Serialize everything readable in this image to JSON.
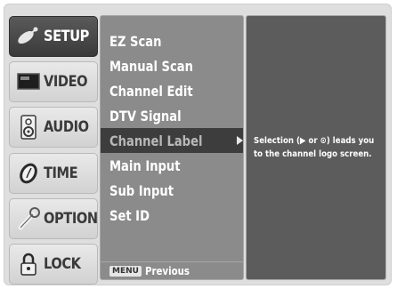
{
  "categories": [
    {
      "label": "SETUP",
      "icon": "satellite-dish-icon",
      "selected": true
    },
    {
      "label": "VIDEO",
      "icon": "tv-screen-icon",
      "selected": false
    },
    {
      "label": "AUDIO",
      "icon": "speaker-icon",
      "selected": false
    },
    {
      "label": "TIME",
      "icon": "clock-icon",
      "selected": false
    },
    {
      "label": "OPTION",
      "icon": "wrench-icon",
      "selected": false
    },
    {
      "label": "LOCK",
      "icon": "padlock-icon",
      "selected": false
    }
  ],
  "menu": {
    "items": [
      {
        "label": "EZ Scan"
      },
      {
        "label": "Manual Scan"
      },
      {
        "label": "Channel Edit"
      },
      {
        "label": "DTV Signal"
      },
      {
        "label": "Channel Label"
      },
      {
        "label": "Main Input"
      },
      {
        "label": "Sub Input"
      },
      {
        "label": "Set ID"
      }
    ],
    "selected_index": 4,
    "footer_key": "MENU",
    "footer_label": "Previous"
  },
  "info": {
    "line1": "Selection (▶ or ⊙) leads you",
    "line2": "to the channel logo screen."
  }
}
